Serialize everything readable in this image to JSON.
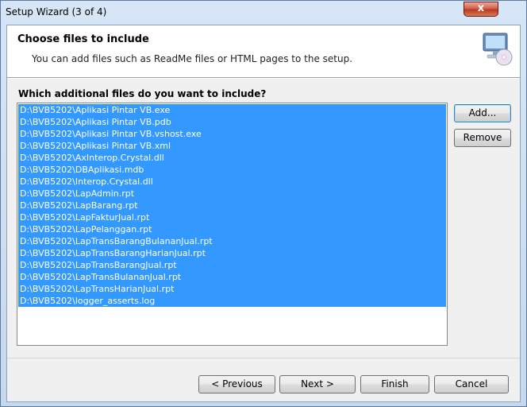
{
  "window": {
    "title": "Setup Wizard (3 of 4)",
    "close_symbol": "x"
  },
  "header": {
    "title": "Choose files to include",
    "description": "You can add files such as ReadMe files or HTML pages to the setup.",
    "icon": "computer-cd-icon"
  },
  "question": "Which additional files do you want to include?",
  "files": [
    "D:\\BVB5202\\Aplikasi Pintar VB.exe",
    "D:\\BVB5202\\Aplikasi Pintar VB.pdb",
    "D:\\BVB5202\\Aplikasi Pintar VB.vshost.exe",
    "D:\\BVB5202\\Aplikasi Pintar VB.xml",
    "D:\\BVB5202\\AxInterop.Crystal.dll",
    "D:\\BVB5202\\DBAplikasi.mdb",
    "D:\\BVB5202\\Interop.Crystal.dll",
    "D:\\BVB5202\\LapAdmin.rpt",
    "D:\\BVB5202\\LapBarang.rpt",
    "D:\\BVB5202\\LapFakturJual.rpt",
    "D:\\BVB5202\\LapPelanggan.rpt",
    "D:\\BVB5202\\LapTransBarangBulananJual.rpt",
    "D:\\BVB5202\\LapTransBarangHarianJual.rpt",
    "D:\\BVB5202\\LapTransBarangJual.rpt",
    "D:\\BVB5202\\LapTransBulananJual.rpt",
    "D:\\BVB5202\\LapTransHarianJual.rpt",
    "D:\\BVB5202\\logger_asserts.log"
  ],
  "buttons": {
    "add": "Add...",
    "remove": "Remove",
    "previous": "< Previous",
    "next": "Next >",
    "finish": "Finish",
    "cancel": "Cancel"
  },
  "colors": {
    "selection": "#3399ff",
    "close_button": "#c7432b"
  }
}
